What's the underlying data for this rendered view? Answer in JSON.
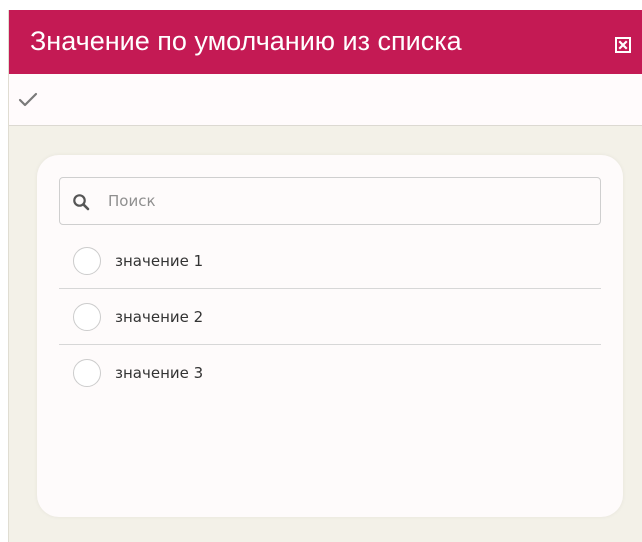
{
  "dialog": {
    "title": "Значение по умолчанию из списка",
    "accent_color": "#c41a54",
    "close_icon": "close-box-icon"
  },
  "toolbar": {
    "confirm_icon": "checkmark-icon"
  },
  "search": {
    "placeholder": "Поиск",
    "value": "",
    "icon": "search-icon"
  },
  "options": [
    {
      "label": "значение 1",
      "selected": false
    },
    {
      "label": "значение 2",
      "selected": false
    },
    {
      "label": "значение 3",
      "selected": false
    }
  ]
}
